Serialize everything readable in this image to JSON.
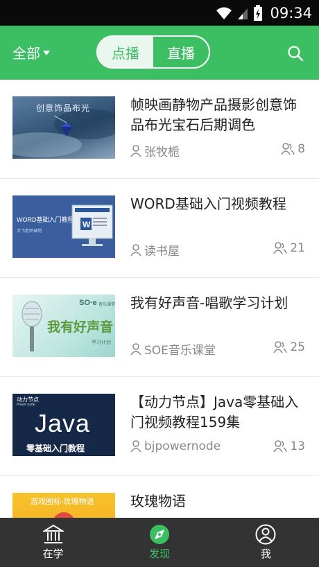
{
  "status": {
    "time": "09:34"
  },
  "header": {
    "filter_label": "全部",
    "segments": [
      {
        "label": "点播",
        "active": true
      },
      {
        "label": "直播",
        "active": false
      }
    ],
    "accent_color": "#3cbe63"
  },
  "courses": [
    {
      "title": "帧映画静物产品摄影创意饰品布光宝石后期调色",
      "author": "张牧栀",
      "count": "8",
      "thumb_text": "创意饰品布光"
    },
    {
      "title": "WORD基础入门视频教程",
      "author": "读书屋",
      "count": "21",
      "thumb_text": "WORD基础入门教程",
      "thumb_sub": "大飞老师录制"
    },
    {
      "title": "我有好声音-唱歌学习计划",
      "author": "SOE音乐课堂",
      "count": "25",
      "thumb_text": "我有好声音",
      "thumb_brand": "SO·e",
      "thumb_brand_sub": "音乐课堂",
      "thumb_sub": "学习计划"
    },
    {
      "title": "【动力节点】Java零基础入门视频教程159集",
      "author": "bjpowernode",
      "count": "13",
      "thumb_text": "Java",
      "thumb_sub": "零基础入门教程",
      "thumb_brand": "动力节点",
      "thumb_brand_sub": "Power node"
    },
    {
      "title": "玫瑰物语",
      "author": "",
      "count": "",
      "thumb_text": "游戏图标-玫瑰物语"
    }
  ],
  "tabs": [
    {
      "label": "在学",
      "icon": "bank-icon",
      "active": false
    },
    {
      "label": "发现",
      "icon": "compass-icon",
      "active": true
    },
    {
      "label": "我",
      "icon": "person-icon",
      "active": false
    }
  ]
}
